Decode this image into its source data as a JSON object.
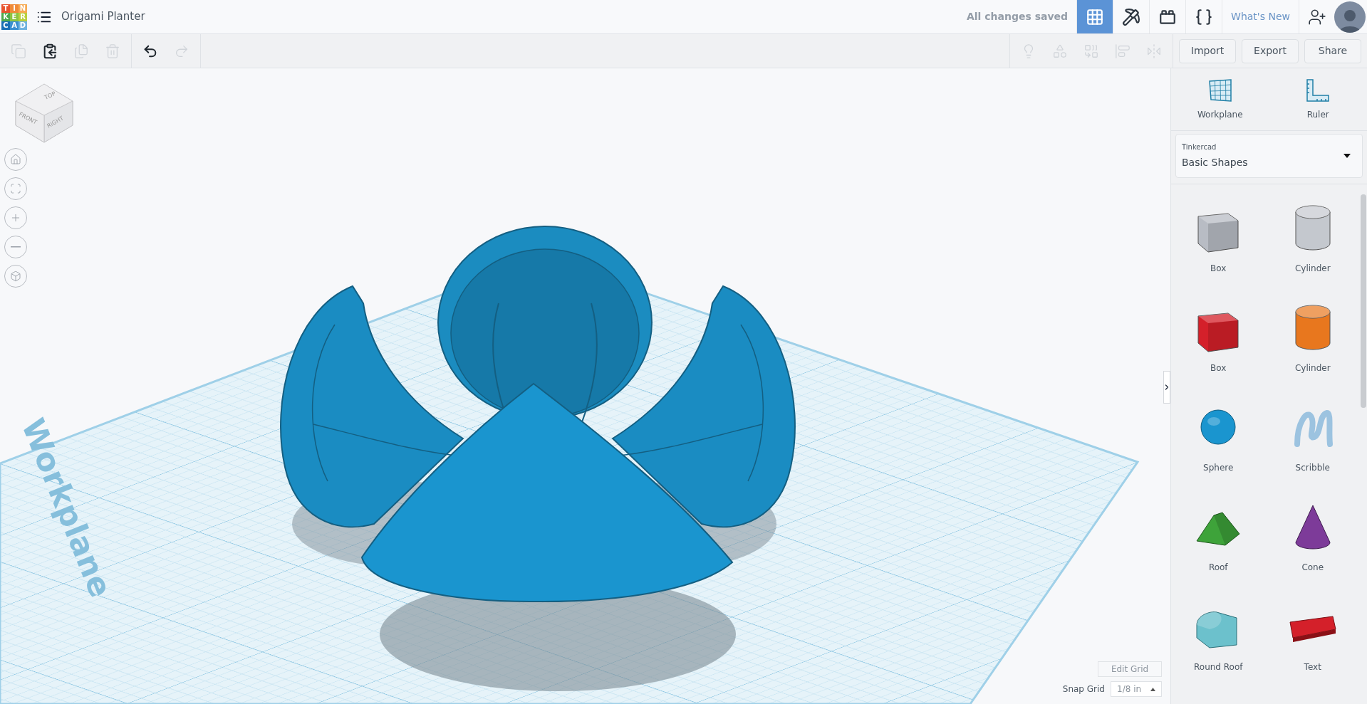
{
  "header": {
    "logo": [
      {
        "letter": "T",
        "color": "#e8532e"
      },
      {
        "letter": "I",
        "color": "#f08a36"
      },
      {
        "letter": "N",
        "color": "#f6a952"
      },
      {
        "letter": "K",
        "color": "#4ea94b"
      },
      {
        "letter": "E",
        "color": "#8cc43f"
      },
      {
        "letter": "R",
        "color": "#b9cf3c"
      },
      {
        "letter": "C",
        "color": "#1a6eb5"
      },
      {
        "letter": "A",
        "color": "#3a8fd0"
      },
      {
        "letter": "D",
        "color": "#6fb3e0"
      }
    ],
    "title": "Origami Planter",
    "save_status": "All changes saved",
    "views": [
      {
        "kind": "grid",
        "selected": true
      },
      {
        "kind": "pickaxe",
        "selected": false
      },
      {
        "kind": "bricks",
        "selected": false
      },
      {
        "kind": "code",
        "selected": false
      }
    ],
    "whats_new": "What's New"
  },
  "toolbar": {
    "edit_tools": [
      {
        "kind": "copy",
        "disabled": true
      },
      {
        "kind": "paste",
        "disabled": false
      },
      {
        "kind": "duplicate",
        "disabled": true
      },
      {
        "kind": "delete",
        "disabled": true
      }
    ],
    "history_tools": [
      {
        "kind": "undo",
        "disabled": false
      },
      {
        "kind": "redo",
        "disabled": true
      }
    ],
    "shape_tools": [
      {
        "kind": "light",
        "disabled": true
      },
      {
        "kind": "group",
        "disabled": true
      },
      {
        "kind": "ungroup",
        "disabled": true
      },
      {
        "kind": "align",
        "disabled": true
      },
      {
        "kind": "mirror",
        "disabled": true
      }
    ],
    "actions": [
      "Import",
      "Export",
      "Share"
    ]
  },
  "view_cube": {
    "faces": [
      "TOP",
      "FRONT",
      "RIGHT"
    ]
  },
  "view_controls": [
    {
      "kind": "home"
    },
    {
      "kind": "fit"
    },
    {
      "kind": "zoom_in"
    },
    {
      "kind": "zoom_out"
    },
    {
      "kind": "perspective"
    }
  ],
  "workplane": {
    "label": "Workplane"
  },
  "grid_controls": {
    "edit_button": "Edit Grid",
    "snap_label": "Snap Grid",
    "snap_value": "1/8 in"
  },
  "sidebar": {
    "tools": [
      {
        "kind": "workplane",
        "label": "Workplane"
      },
      {
        "kind": "ruler",
        "label": "Ruler"
      }
    ],
    "library": {
      "caption": "Tinkercad",
      "value": "Basic Shapes"
    },
    "shapes": [
      {
        "kind": "box",
        "label": "Box",
        "color": "#b8bcc4"
      },
      {
        "kind": "cylinder",
        "label": "Cylinder",
        "color": "#c4c8ce"
      },
      {
        "kind": "box",
        "label": "Box",
        "color": "#d4202a"
      },
      {
        "kind": "cylinder",
        "label": "Cylinder",
        "color": "#e8771e"
      },
      {
        "kind": "sphere",
        "label": "Sphere",
        "color": "#1a95cf"
      },
      {
        "kind": "scribble",
        "label": "Scribble",
        "color": "#9cc3e0"
      },
      {
        "kind": "roof",
        "label": "Roof",
        "color": "#3ea33a"
      },
      {
        "kind": "cone",
        "label": "Cone",
        "color": "#7d3b99"
      },
      {
        "kind": "round_roof",
        "label": "Round Roof",
        "color": "#6cc1cc"
      },
      {
        "kind": "text",
        "label": "Text",
        "color": "#d4202a"
      }
    ]
  }
}
